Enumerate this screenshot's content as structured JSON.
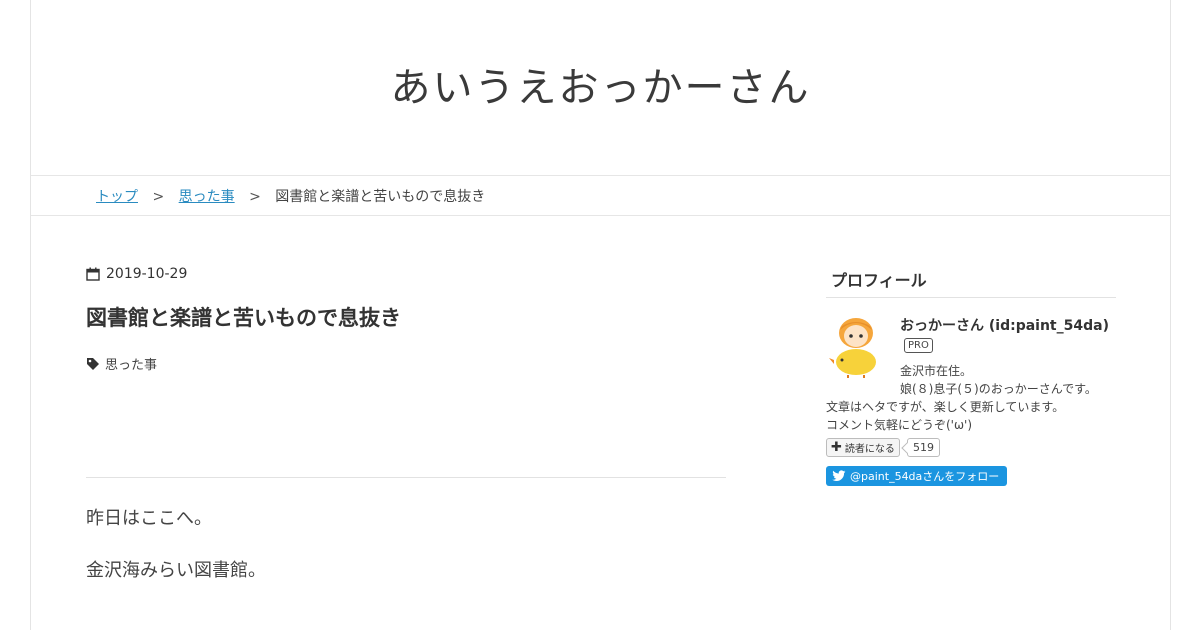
{
  "header": {
    "blog_title": "あいうえおっかーさん"
  },
  "breadcrumb": {
    "home": "トップ",
    "category": "思った事",
    "current": "図書館と楽譜と苦いもので息抜き",
    "separator": ">"
  },
  "entry": {
    "date": "2019-10-29",
    "title": "図書館と楽譜と苦いもので息抜き",
    "category": "思った事",
    "paragraphs": [
      "昨日はここへ。",
      "金沢海みらい図書館。"
    ]
  },
  "sidebar": {
    "module_title": "プロフィール",
    "profile": {
      "name": "おっかーさん (id:paint_54da)",
      "badge": "PRO",
      "bio_lines": [
        "金沢市在住。",
        "娘(８)息子(５)のおっかーさんです。",
        "文章はヘタですが、楽しく更新しています。",
        "コメント気軽にどうぞ('ω')"
      ],
      "subscribe_label": "読者になる",
      "subscriber_count": "519",
      "twitter_follow_label": "@paint_54daさんをフォロー"
    }
  },
  "colors": {
    "link": "#2a8bc0",
    "twitter": "#1b95e0",
    "border": "#e6e6e6"
  },
  "icons": {
    "date": "calendar-icon",
    "category": "tag-icon",
    "subscribe": "plus-icon",
    "twitter": "twitter-bird-icon"
  }
}
